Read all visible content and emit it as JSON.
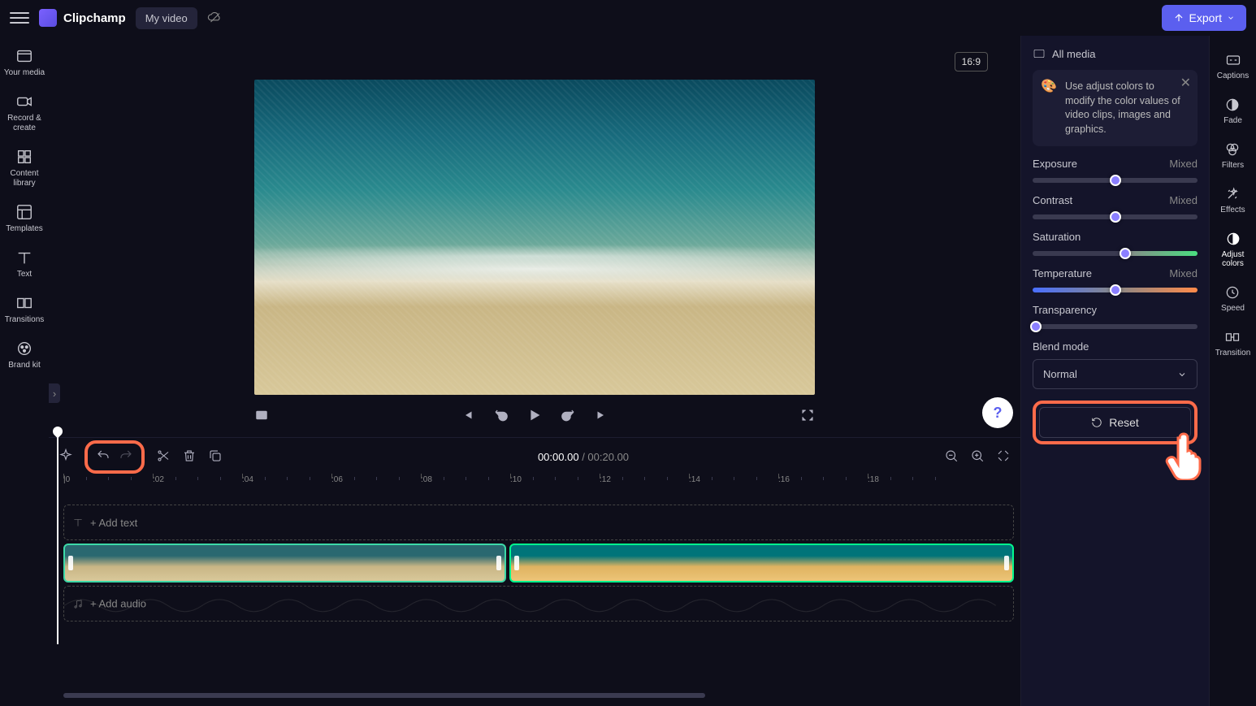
{
  "header": {
    "brand": "Clipchamp",
    "project_name": "My video",
    "export_label": "Export"
  },
  "left_nav": [
    {
      "id": "your-media",
      "label": "Your media"
    },
    {
      "id": "record-create",
      "label": "Record & create"
    },
    {
      "id": "content-library",
      "label": "Content library"
    },
    {
      "id": "templates",
      "label": "Templates"
    },
    {
      "id": "text",
      "label": "Text"
    },
    {
      "id": "transitions",
      "label": "Transitions"
    },
    {
      "id": "brand-kit",
      "label": "Brand kit"
    }
  ],
  "preview": {
    "aspect": "16:9"
  },
  "timeline": {
    "current_time": "00:00.00",
    "total_time": "00:20.00",
    "ticks": [
      "|0",
      ":02",
      ":04",
      ":06",
      ":08",
      ":10",
      ":12",
      ":14",
      ":16",
      ":18"
    ],
    "add_text_label": "+ Add text",
    "add_audio_label": "+ Add audio"
  },
  "properties": {
    "header": "All media",
    "tip": "Use adjust colors to modify the color values of video clips, images and graphics.",
    "sliders": {
      "exposure": {
        "label": "Exposure",
        "value": "Mixed",
        "pos": 50
      },
      "contrast": {
        "label": "Contrast",
        "value": "Mixed",
        "pos": 50
      },
      "saturation": {
        "label": "Saturation",
        "value": "",
        "pos": 56
      },
      "temperature": {
        "label": "Temperature",
        "value": "Mixed",
        "pos": 50
      },
      "transparency": {
        "label": "Transparency",
        "value": "",
        "pos": 0
      }
    },
    "blend_label": "Blend mode",
    "blend_value": "Normal",
    "reset_label": "Reset"
  },
  "right_tools": [
    {
      "id": "captions",
      "label": "Captions"
    },
    {
      "id": "fade",
      "label": "Fade"
    },
    {
      "id": "filters",
      "label": "Filters"
    },
    {
      "id": "effects",
      "label": "Effects"
    },
    {
      "id": "adjust-colors",
      "label": "Adjust colors",
      "active": true
    },
    {
      "id": "speed",
      "label": "Speed"
    },
    {
      "id": "transition",
      "label": "Transition"
    }
  ]
}
